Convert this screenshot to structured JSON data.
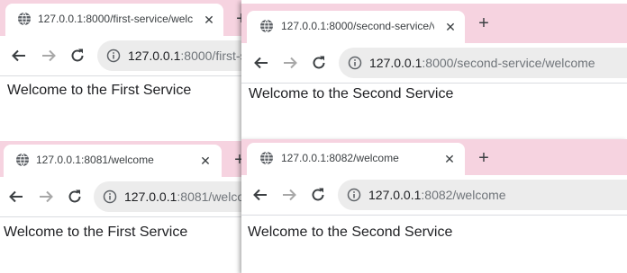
{
  "windows": {
    "w1": {
      "tab_title": "127.0.0.1:8000/first-service/welc",
      "close_glyph": "✕",
      "new_tab_glyph": "+",
      "url_host": "127.0.0.1",
      "url_rest": ":8000/first-s",
      "content": "Welcome to the First Service"
    },
    "w2": {
      "tab_title": "127.0.0.1:8000/second-service/v",
      "close_glyph": "✕",
      "new_tab_glyph": "+",
      "url_host": "127.0.0.1",
      "url_rest": ":8000/second-service/welcome",
      "content": "Welcome to the Second Service"
    },
    "w3": {
      "tab_title": "127.0.0.1:8081/welcome",
      "close_glyph": "✕",
      "new_tab_glyph": "+",
      "url_host": "127.0.0.1",
      "url_rest": ":8081/welco",
      "content": "Welcome to the First Service"
    },
    "w4": {
      "tab_title": "127.0.0.1:8082/welcome",
      "close_glyph": "✕",
      "new_tab_glyph": "+",
      "url_host": "127.0.0.1",
      "url_rest": ":8082/welcome",
      "content": "Welcome to the Second Service"
    }
  },
  "icons": {
    "globe": "globe-icon",
    "back": "back-arrow-icon",
    "forward": "forward-arrow-icon",
    "reload": "reload-icon",
    "info": "info-icon"
  },
  "colors": {
    "tabstrip_bg": "#f6d3e0",
    "omnibox_bg": "#ececec",
    "url_host": "#202124",
    "url_path": "#70757a",
    "forward_disabled": "#a8a8a8"
  }
}
